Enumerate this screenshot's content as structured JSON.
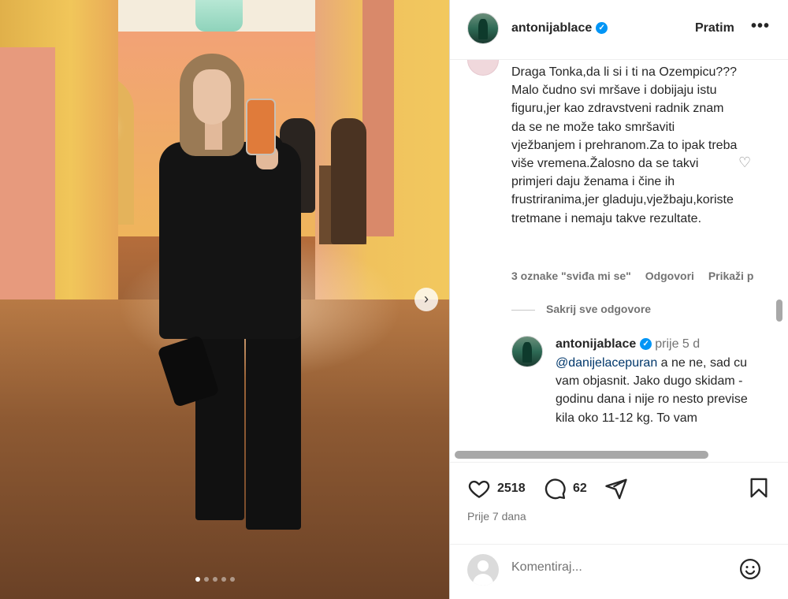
{
  "post": {
    "carousel": {
      "dots": 5,
      "active_index": 0
    }
  },
  "header": {
    "username": "antonijablace",
    "verified": true,
    "follow_label": "Pratim",
    "more_label": "•••"
  },
  "comment": {
    "text": "Draga Tonka,da li si i ti na Ozempicu???Malo čudno svi mršave i dobijaju istu figuru,jer kao zdravstveni radnik znam da se ne može tako smršaviti vježbanjem i prehranom.Za to ipak treba više vremena.Žalosno da se takvi primjeri daju ženama i čine ih frustriranima,jer gladuju,vježbaju,koriste tretmane i nemaju takve rezultate.",
    "likes_label": "3 oznake \"sviđa mi se\"",
    "reply_label": "Odgovori",
    "translate_label": "Prikaži p",
    "hide_replies_label": "Sakrij sve odgovore"
  },
  "reply": {
    "username": "antonijablace",
    "verified": true,
    "time": "prije 5 d",
    "mention": "@danijelacepuran",
    "text": " a ne ne, sad cu vam objasnit. Jako dugo skidam - godinu dana i nije ro nesto previse kila oko 11-12 kg. To vam"
  },
  "actions": {
    "likes_count": "2518",
    "comments_count": "62",
    "post_date": "Prije 7 dana"
  },
  "add_comment": {
    "placeholder": "Komentiraj..."
  },
  "colors": {
    "verified_blue": "#0095f6",
    "secondary_text": "#737373",
    "link": "#00376b"
  }
}
